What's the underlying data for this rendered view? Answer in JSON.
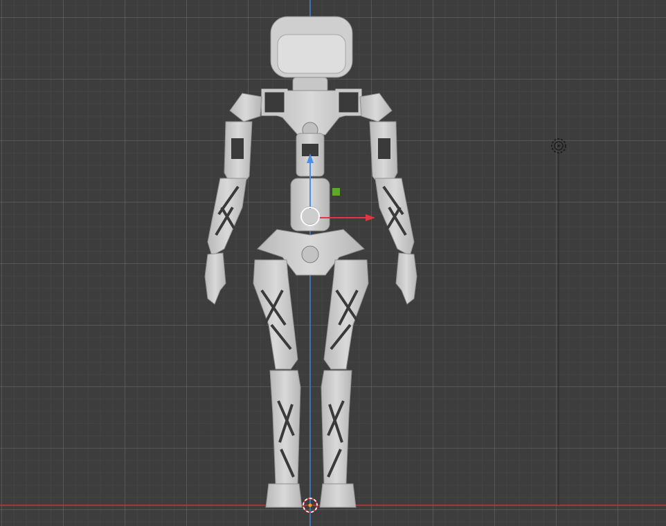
{
  "app": "3D viewport",
  "viewport": {
    "view": "front-orthographic",
    "grid": true,
    "axes": {
      "x_axis_color": "#c0393b",
      "z_axis_color": "#3f7fd6"
    },
    "object": {
      "name": "robot",
      "material_color": "#cfcfcf"
    },
    "gizmo": {
      "type": "move",
      "x_color": "#e0363f",
      "z_color": "#4a8fe8",
      "plane_handle_color": "#5fa82f"
    },
    "cursor": {
      "type": "3d-cursor"
    },
    "light": {
      "type": "light-object"
    }
  }
}
